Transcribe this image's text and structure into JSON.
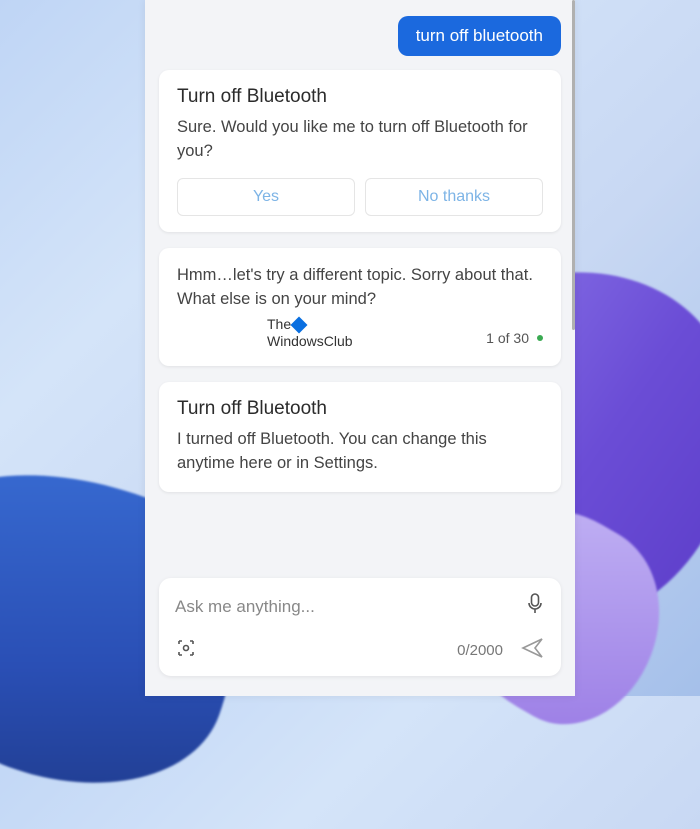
{
  "user_message": "turn off bluetooth",
  "cards": {
    "confirm": {
      "title": "Turn off Bluetooth",
      "body": "Sure. Would you like me to turn off Bluetooth for you?",
      "yes": "Yes",
      "no": "No thanks"
    },
    "fallback": {
      "body": "Hmm…let's try a different topic. Sorry about that. What else is on your mind?",
      "counter": "1 of 30"
    },
    "done": {
      "title": "Turn off Bluetooth",
      "body": "I turned off Bluetooth. You can change this anytime here or in Settings."
    }
  },
  "watermark": {
    "line1": "The",
    "line2": "WindowsClub"
  },
  "input": {
    "placeholder": "Ask me anything...",
    "char_count": "0/2000"
  }
}
